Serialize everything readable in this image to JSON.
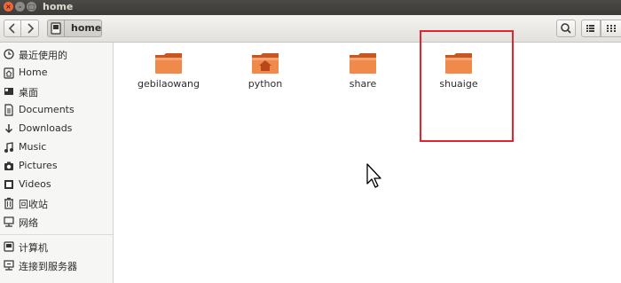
{
  "window": {
    "title": "home"
  },
  "toolbar": {
    "back_icon": "chevron-left-icon",
    "forward_icon": "chevron-right-icon",
    "breadcrumb_home_label": "home",
    "search_icon": "search-icon",
    "list_view_icon": "list-view-icon",
    "grid_view_icon": "grid-view-icon"
  },
  "sidebar": {
    "items": [
      {
        "label": "最近使用的",
        "icon": "clock-icon"
      },
      {
        "label": "Home",
        "icon": "home-icon"
      },
      {
        "label": "桌面",
        "icon": "desktop-icon"
      },
      {
        "label": "Documents",
        "icon": "document-icon"
      },
      {
        "label": "Downloads",
        "icon": "download-icon"
      },
      {
        "label": "Music",
        "icon": "music-icon"
      },
      {
        "label": "Pictures",
        "icon": "camera-icon"
      },
      {
        "label": "Videos",
        "icon": "video-icon"
      },
      {
        "label": "回收站",
        "icon": "trash-icon"
      },
      {
        "label": "网络",
        "icon": "network-icon"
      },
      {
        "label": "计算机",
        "icon": "computer-icon"
      },
      {
        "label": "连接到服务器",
        "icon": "server-connect-icon"
      }
    ]
  },
  "files": [
    {
      "name": "gebilaowang",
      "icon": "folder-icon"
    },
    {
      "name": "python",
      "icon": "home-folder-icon"
    },
    {
      "name": "share",
      "icon": "folder-icon"
    },
    {
      "name": "shuaige",
      "icon": "folder-icon"
    }
  ],
  "colors": {
    "folder": "#f07b3c",
    "highlight": "#e5232c",
    "titlebar": "#3c3b37"
  }
}
